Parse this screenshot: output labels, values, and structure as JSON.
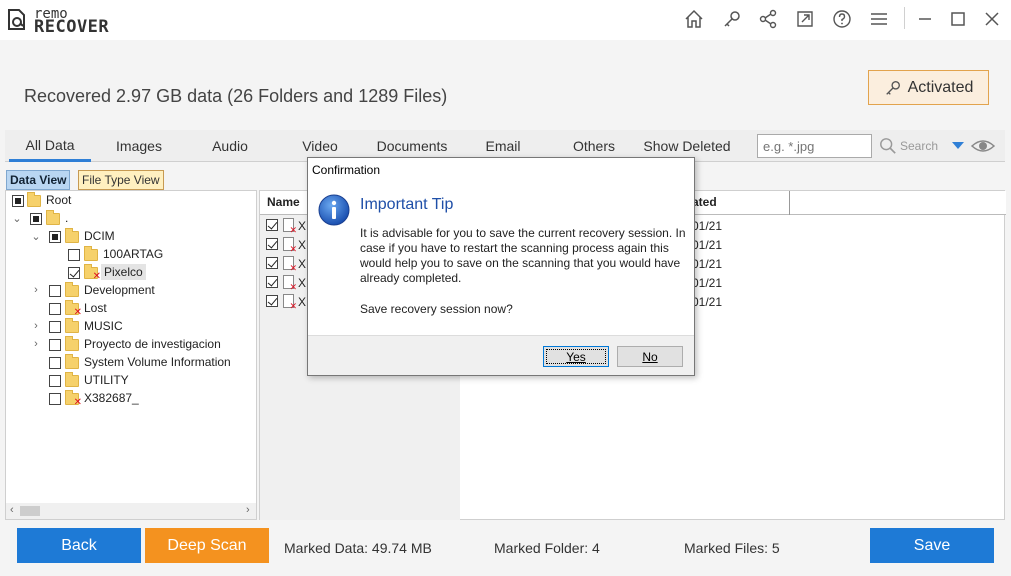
{
  "app": {
    "logo_line1": "remo",
    "logo_line2": "RECOVER",
    "brand_accent": "#e03a3a"
  },
  "titlebar": {
    "icons": [
      "home-icon",
      "key-icon",
      "share-icon",
      "export-icon",
      "help-icon",
      "menu-icon",
      "minimize-icon",
      "maximize-icon",
      "close-icon"
    ]
  },
  "status": {
    "recovered_text": "Recovered 2.97 GB data (26 Folders and 1289 Files)",
    "activated_label": "Activated"
  },
  "tabs": [
    {
      "label": "All Data",
      "active": true
    },
    {
      "label": "Images"
    },
    {
      "label": "Audio"
    },
    {
      "label": "Video"
    },
    {
      "label": "Documents"
    },
    {
      "label": "Email"
    },
    {
      "label": "Others"
    },
    {
      "label": "Show Deleted"
    }
  ],
  "search": {
    "placeholder": "e.g. *.jpg",
    "button_label": "Search"
  },
  "view_tabs": {
    "data_view": "Data View",
    "file_type_view": "File Type View"
  },
  "tree": {
    "items": [
      {
        "label": "Root",
        "state": "partial"
      },
      {
        "label": ".",
        "state": "partial"
      },
      {
        "label": "DCIM",
        "state": "partial"
      },
      {
        "label": "100ARTAG",
        "state": "unchecked"
      },
      {
        "label": "Pixelco",
        "state": "checked",
        "deleted": true,
        "selected": true
      },
      {
        "label": "Development",
        "state": "unchecked"
      },
      {
        "label": "Lost",
        "state": "unchecked",
        "deleted": true
      },
      {
        "label": "MUSIC",
        "state": "unchecked"
      },
      {
        "label": "Proyecto de investigacion",
        "state": "unchecked"
      },
      {
        "label": "System Volume Information",
        "state": "unchecked"
      },
      {
        "label": "UTILITY",
        "state": "unchecked"
      },
      {
        "label": "X382687_",
        "state": "unchecked",
        "deleted": true
      }
    ]
  },
  "file_list": {
    "col_name": "Name",
    "col_date": "ated",
    "rows": [
      {
        "name": "XI",
        "date": "01/21"
      },
      {
        "name": "XI",
        "date": "01/21"
      },
      {
        "name": "XI",
        "date": "01/21"
      },
      {
        "name": "XI",
        "date": "01/21"
      },
      {
        "name": "XI",
        "date": "01/21"
      }
    ]
  },
  "bottom": {
    "back_label": "Back",
    "deep_scan_label": "Deep Scan",
    "marked_data": "Marked Data: 49.74 MB",
    "marked_folder": "Marked Folder:  4",
    "marked_files": "Marked Files: 5",
    "save_label": "Save"
  },
  "dialog": {
    "title": "Confirmation",
    "heading": "Important Tip",
    "message": "It is advisable for you to save the current recovery session. In case if you have to restart the scanning process again this would help you to save on the scanning that you would have already completed.",
    "question": "Save recovery session now?",
    "yes_label": "Yes",
    "no_label": "No"
  },
  "colors": {
    "primary_blue": "#1e7ad6",
    "deep_scan_orange": "#f4921f",
    "active_tab_underline": "#2f7fd6",
    "activated_border": "#e2a34d"
  }
}
